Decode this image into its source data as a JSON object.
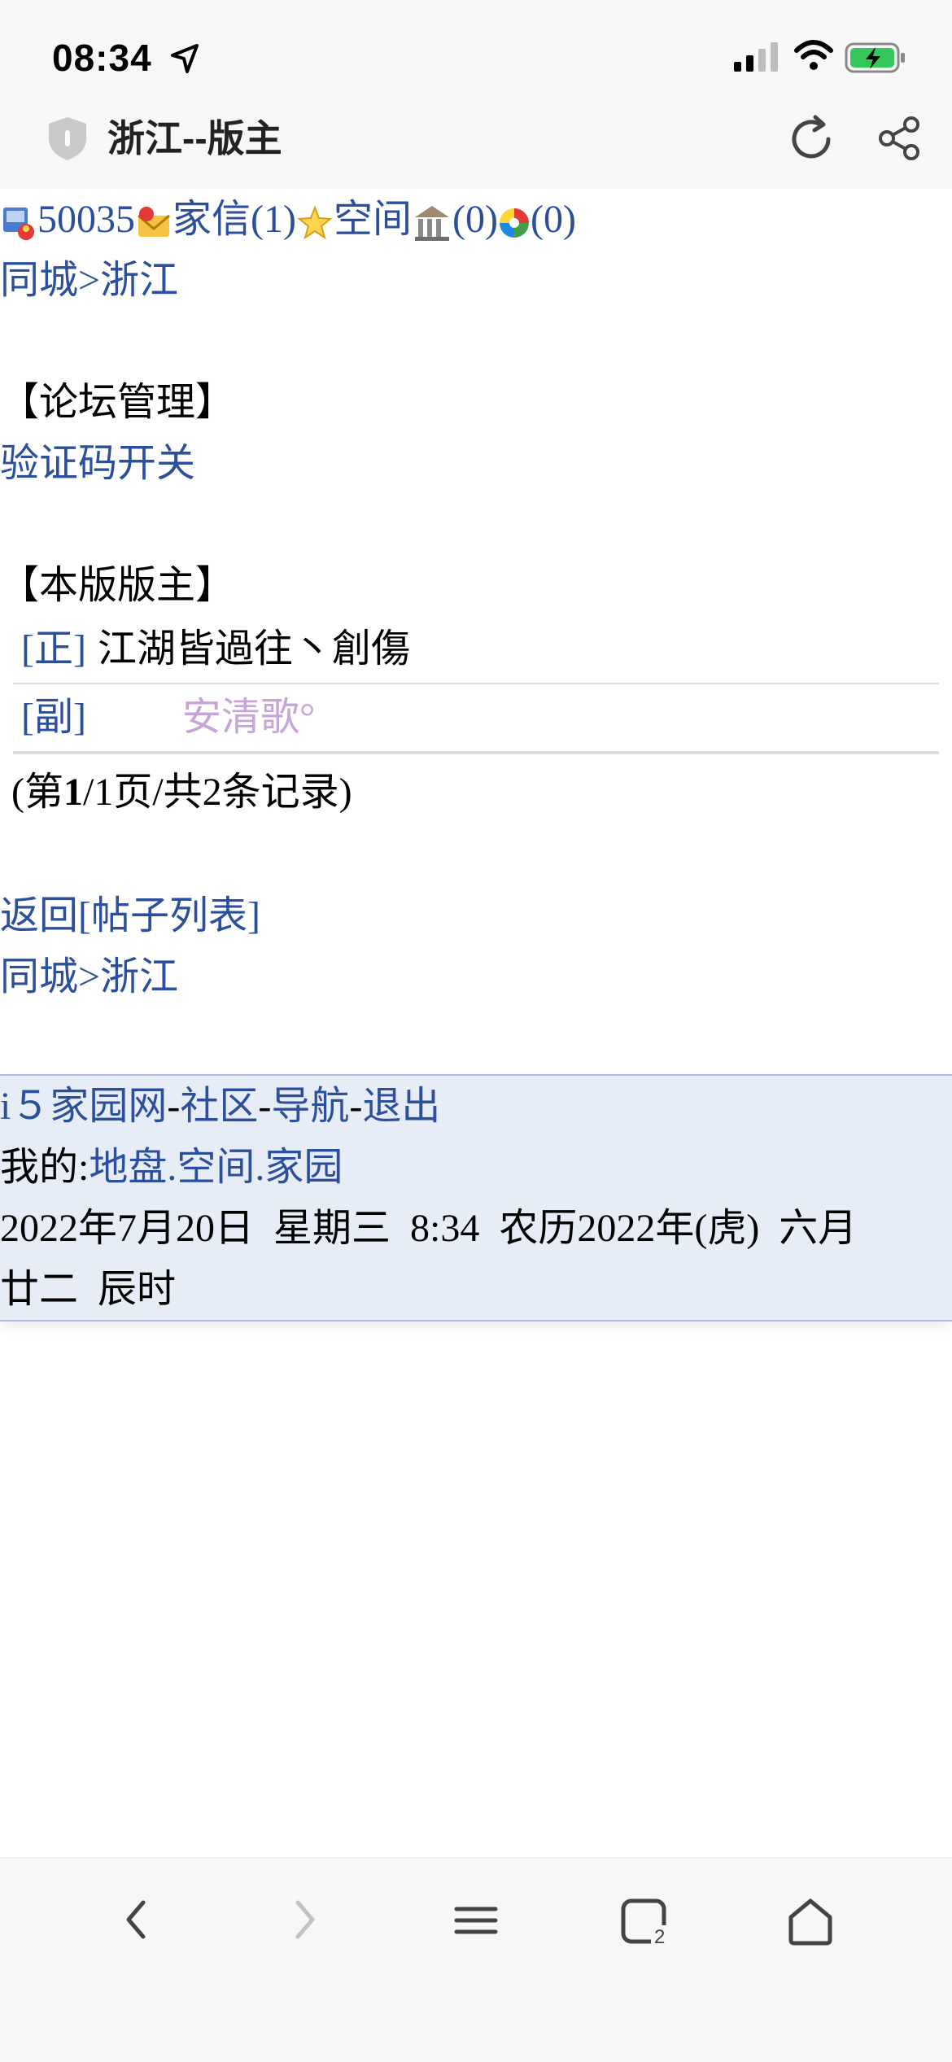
{
  "status": {
    "time": "08:34"
  },
  "browser": {
    "title": "浙江--版主"
  },
  "userbar": {
    "user_id": "50035",
    "mail": "家信(1)",
    "space": "空间",
    "count1": "(0)",
    "count2": "(0)"
  },
  "breadcrumb": {
    "city": "同城",
    "sep": ">",
    "region": "浙江"
  },
  "forum_admin": {
    "heading": "【论坛管理】",
    "captcha_toggle": "验证码开关"
  },
  "moderators": {
    "heading": "【本版版主】",
    "rows": [
      {
        "tag": "[正]",
        "name": "江湖皆過往丶創傷"
      },
      {
        "tag": "[副]",
        "name": "安清歌°"
      }
    ]
  },
  "pager": {
    "prefix": "(第",
    "page": "1",
    "suffix": "/1页/共2条记录)"
  },
  "back": {
    "label": "返回",
    "list": "[帖子列表]"
  },
  "footer": {
    "site": "i５家园网",
    "dash": "-",
    "community": "社区",
    "nav": "导航",
    "logout": "退出",
    "mine": "我的:",
    "land": "地盘",
    "dot": ".",
    "space": "空间",
    "home": "家园",
    "date_line1": "2022年7月20日  星期三  8:34  农历2022年(虎)  六月",
    "date_line2": "廿二  辰时"
  }
}
